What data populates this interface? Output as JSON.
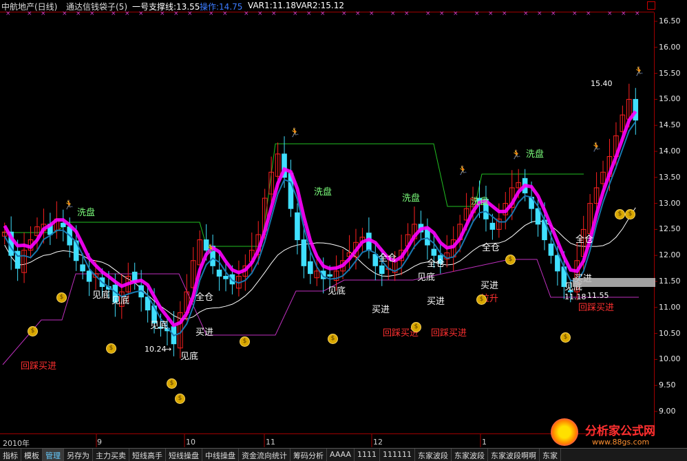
{
  "header": {
    "stock": "中航地产(日线)",
    "indicator": "通达信钱袋子(5)",
    "support_label": "一号支撑线:13.55",
    "operate_label": "操作:14.75",
    "var1_label": "VAR1:11.18",
    "var2_label": "VAR2:15.12"
  },
  "colors": {
    "up": "#ff2020",
    "down": "#40e0ff",
    "band": "#ff00ff",
    "band_dark": "#1878b0",
    "ma_white": "#ffffff",
    "green": "#22c022",
    "purple": "#c030c0",
    "axis": "#a00000"
  },
  "annotations": {
    "xipan1": "洗盘",
    "xipan2": "洗盘",
    "xipan3": "洗盘",
    "xipan4": "洗盘",
    "xipan5": "洗盘",
    "jiandi1": "见底",
    "jiandi2": "见底",
    "jiandi3": "见底",
    "jiandi4": "见底",
    "jiandi5": "见底",
    "jiandi6": "见底",
    "jiandi7": "见底",
    "quancang1": "全仓",
    "quancang2": "全仓",
    "quancang3": "全仓",
    "quancang4": "全仓",
    "quancang5": "全仓",
    "maijin1": "买进",
    "maijin2": "买进",
    "maijin3": "买进",
    "maijin4": "买进",
    "maijin5": "买进",
    "huicai1": "回踩买进",
    "huicai2": "回踩买进",
    "huicai3": "回踩买进",
    "huicai4": "回踩买进",
    "lasheng": "拉升",
    "low_label": "10.24",
    "high_label": "15.40",
    "last_low_label": "11.55",
    "mid_low_label": "11.18"
  },
  "yaxis_ticks": [
    "16.50",
    "16.00",
    "15.50",
    "15.00",
    "14.50",
    "14.00",
    "13.50",
    "13.00",
    "12.50",
    "12.00",
    "11.50",
    "11.00",
    "10.50",
    "10.00",
    "9.50",
    "9.00"
  ],
  "xaxis_labels": [
    "2010年",
    "9",
    "10",
    "11",
    "12",
    "1"
  ],
  "tabs": [
    "指标",
    "模板",
    "管理",
    "另存为",
    "主力买卖",
    "短线高手",
    "短线操盘",
    "中线操盘",
    "资金流向统计",
    "筹码分析",
    "AAAA",
    "1111",
    "111111",
    "东家波段",
    "东家波段",
    "东家波段啊啊",
    "东家"
  ],
  "watermark": {
    "site": "分析家公式网",
    "url": "www.88gs.com"
  },
  "chart_data": {
    "type": "candlestick",
    "title": "中航地产(日线)",
    "ylim": [
      9.0,
      16.6
    ],
    "series": [
      {
        "name": "close",
        "values": [
          12.45,
          12.0,
          11.75,
          12.1,
          12.3,
          12.55,
          12.6,
          12.4,
          12.7,
          12.55,
          12.2,
          11.9,
          11.7,
          11.5,
          11.65,
          11.4,
          11.35,
          11.1,
          11.3,
          11.6,
          11.5,
          11.2,
          10.95,
          10.7,
          10.6,
          10.55,
          10.3,
          10.9,
          11.3,
          11.9,
          12.3,
          12.1,
          11.8,
          11.6,
          11.55,
          11.45,
          11.6,
          11.8,
          12.1,
          12.4,
          13.1,
          13.6,
          13.95,
          13.5,
          12.9,
          12.3,
          11.8,
          11.65,
          11.7,
          11.55,
          11.6,
          11.7,
          11.9,
          12.05,
          12.25,
          12.35,
          12.1,
          11.8,
          11.65,
          11.75,
          11.9,
          12.1,
          12.4,
          12.6,
          12.45,
          12.2,
          12.0,
          11.85,
          12.05,
          12.3,
          12.6,
          12.9,
          13.1,
          13.0,
          12.7,
          12.5,
          12.7,
          13.0,
          13.3,
          13.4,
          13.2,
          12.9,
          12.6,
          12.3,
          12.0,
          11.7,
          11.4,
          11.3,
          11.9,
          12.5,
          13.0,
          13.3,
          13.6,
          13.9,
          14.3,
          14.7,
          15.0,
          14.6
        ]
      }
    ],
    "levels": {
      "support": 13.55,
      "operate": 14.75,
      "var1": 11.18,
      "var2": 15.12
    },
    "xlabels": [
      "2010年",
      "9",
      "10",
      "11",
      "12",
      "1"
    ]
  }
}
